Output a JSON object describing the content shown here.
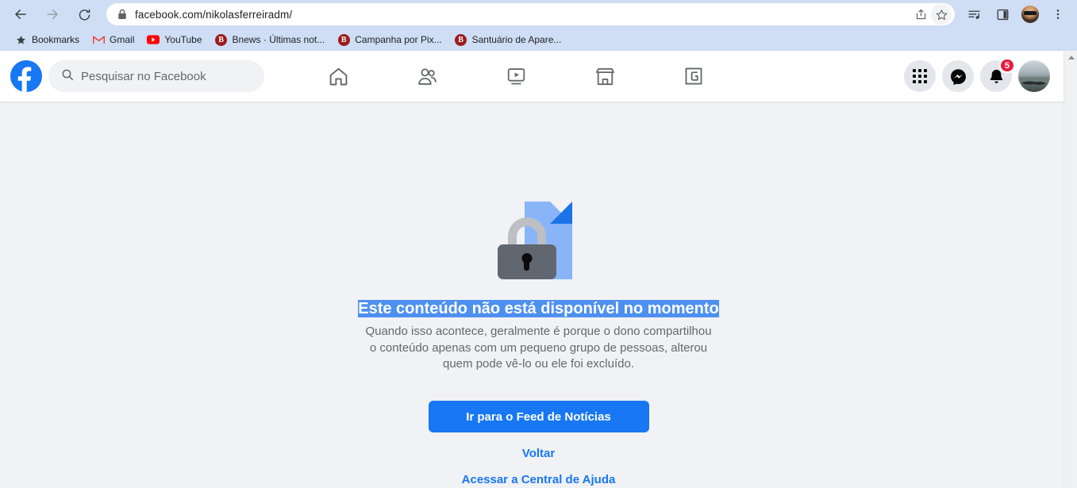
{
  "browser": {
    "back_icon": "back-arrow-icon",
    "forward_icon": "forward-arrow-icon",
    "reload_icon": "reload-icon",
    "omnibox": {
      "lock_icon": "lock-icon",
      "url": "facebook.com/nikolasferreiradm/",
      "share_icon": "share-icon",
      "star_icon": "star-icon"
    },
    "toolbar_icons": [
      "media-control-icon",
      "side-panel-icon",
      "profile-avatar",
      "three-dot-menu-icon"
    ],
    "bookmarks": [
      {
        "label": "Bookmarks",
        "icon": "star-filled-icon"
      },
      {
        "label": "Gmail",
        "icon": "gmail-icon"
      },
      {
        "label": "YouTube",
        "icon": "youtube-icon"
      },
      {
        "label": "Bnews · Últimas not...",
        "icon": "bnews-icon"
      },
      {
        "label": "Campanha por Pix...",
        "icon": "bnews-icon"
      },
      {
        "label": "Santuário de Apare...",
        "icon": "bnews-icon"
      }
    ]
  },
  "facebook": {
    "logo": "facebook-logo",
    "search": {
      "icon": "search-icon",
      "placeholder": "Pesquisar no Facebook",
      "value": ""
    },
    "nav": [
      {
        "name": "home",
        "icon": "home-icon"
      },
      {
        "name": "friends",
        "icon": "friends-icon"
      },
      {
        "name": "watch",
        "icon": "video-play-icon"
      },
      {
        "name": "marketplace",
        "icon": "storefront-icon"
      },
      {
        "name": "gaming",
        "icon": "gaming-icon"
      }
    ],
    "right": {
      "menu_icon": "grid-menu-icon",
      "messenger_icon": "messenger-icon",
      "notifications_icon": "bell-icon",
      "notifications_count": "5",
      "avatar": "user-avatar"
    }
  },
  "content": {
    "illustration": "locked-document-icon",
    "title": "Este conteúdo não está disponível no momento",
    "description": "Quando isso acontece, geralmente é porque o dono compartilhou o conteúdo apenas com um pequeno grupo de pessoas, alterou quem pode vê-lo ou ele foi excluído.",
    "primary_button": "Ir para o Feed de Notícias",
    "back_link": "Voltar",
    "help_link": "Acessar a Central de Ajuda"
  },
  "colors": {
    "fb_blue": "#1877f2",
    "page_bg": "#f0f2f5",
    "selection_blue": "#4d90f0",
    "badge_red": "#e41e3f",
    "chrome_bg": "#cfdef5"
  }
}
